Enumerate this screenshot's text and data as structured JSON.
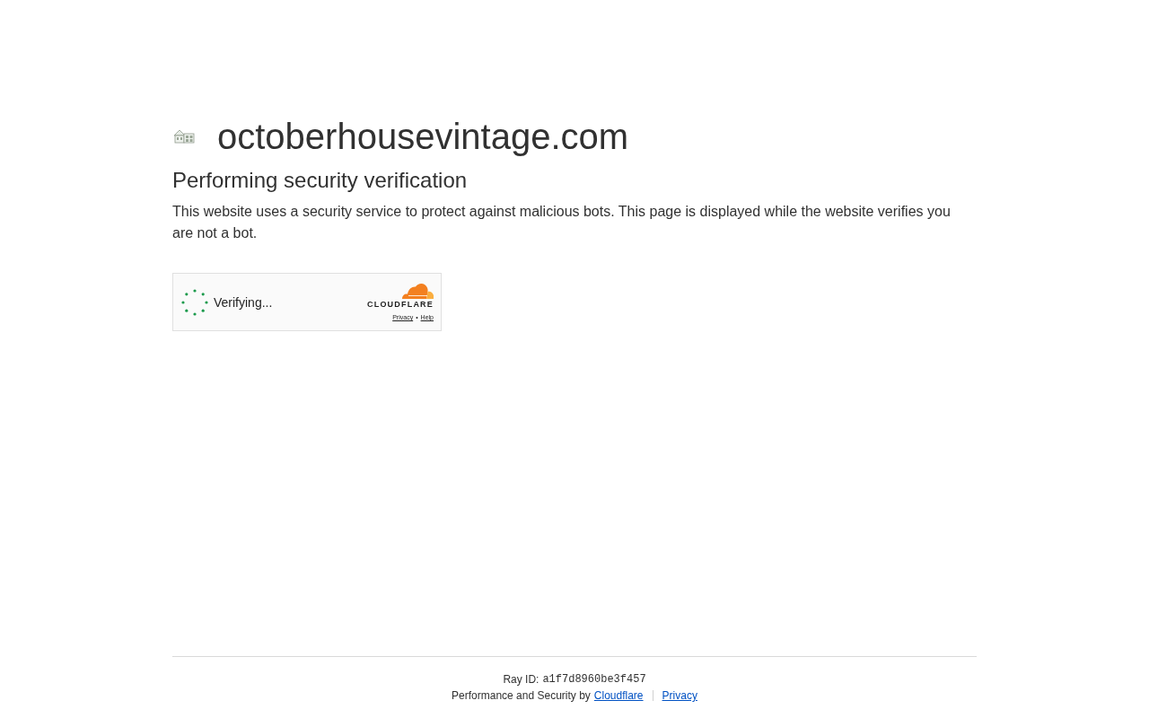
{
  "site": {
    "domain": "octoberhousevintage.com"
  },
  "heading": "Performing security verification",
  "description": "This website uses a security service to protect against malicious bots. This page is displayed while the website verifies you are not a bot.",
  "widget": {
    "status": "Verifying...",
    "brand": "CLOUDFLARE",
    "links": [
      {
        "label": "Privacy"
      },
      {
        "label": "Help"
      }
    ],
    "separator": "•"
  },
  "footer": {
    "ray_label": "Ray ID:",
    "ray_id": "a1f7d8960be3f457",
    "attribution": "Performance and Security by",
    "links": [
      {
        "label": "Cloudflare"
      },
      {
        "label": "Privacy"
      }
    ]
  }
}
